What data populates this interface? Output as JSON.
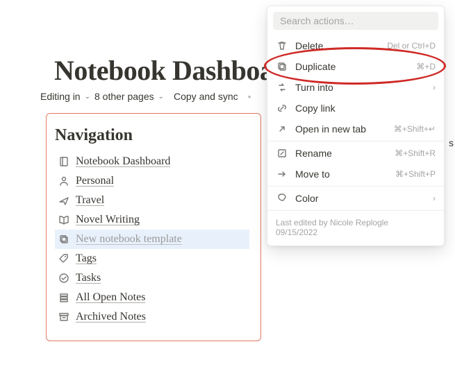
{
  "page": {
    "title": "Notebook Dashboard"
  },
  "toolbar": {
    "editing_label": "Editing in",
    "pages_label": "8 other pages",
    "copy_sync_label": "Copy and sync"
  },
  "nav": {
    "heading": "Navigation",
    "items": [
      {
        "label": "Notebook Dashboard",
        "icon": "notebook"
      },
      {
        "label": "Personal",
        "icon": "user"
      },
      {
        "label": "Travel",
        "icon": "plane"
      },
      {
        "label": "Novel Writing",
        "icon": "book"
      },
      {
        "label": "New notebook template",
        "icon": "duplicate",
        "selected": true,
        "muted": true
      },
      {
        "label": "Tags",
        "icon": "tag"
      },
      {
        "label": "Tasks",
        "icon": "checkcircle"
      },
      {
        "label": "All Open Notes",
        "icon": "stack"
      },
      {
        "label": "Archived Notes",
        "icon": "archive"
      }
    ]
  },
  "menu": {
    "search_placeholder": "Search actions…",
    "items_a": [
      {
        "label": "Delete",
        "icon": "trash",
        "shortcut": "Del or Ctrl+D"
      },
      {
        "label": "Duplicate",
        "icon": "duplicate",
        "shortcut": "⌘+D"
      },
      {
        "label": "Turn into",
        "icon": "turninto",
        "arrow": true
      },
      {
        "label": "Copy link",
        "icon": "link"
      },
      {
        "label": "Open in new tab",
        "icon": "newtab",
        "shortcut": "⌘+Shift+↵"
      }
    ],
    "items_b": [
      {
        "label": "Rename",
        "icon": "rename",
        "shortcut": "⌘+Shift+R"
      },
      {
        "label": "Move to",
        "icon": "moveto",
        "shortcut": "⌘+Shift+P"
      }
    ],
    "items_c": [
      {
        "label": "Color",
        "icon": "color",
        "arrow": true
      }
    ],
    "footer_line1": "Last edited by Nicole Replogle",
    "footer_line2": "09/15/2022"
  },
  "stray": {
    "s": "s"
  }
}
